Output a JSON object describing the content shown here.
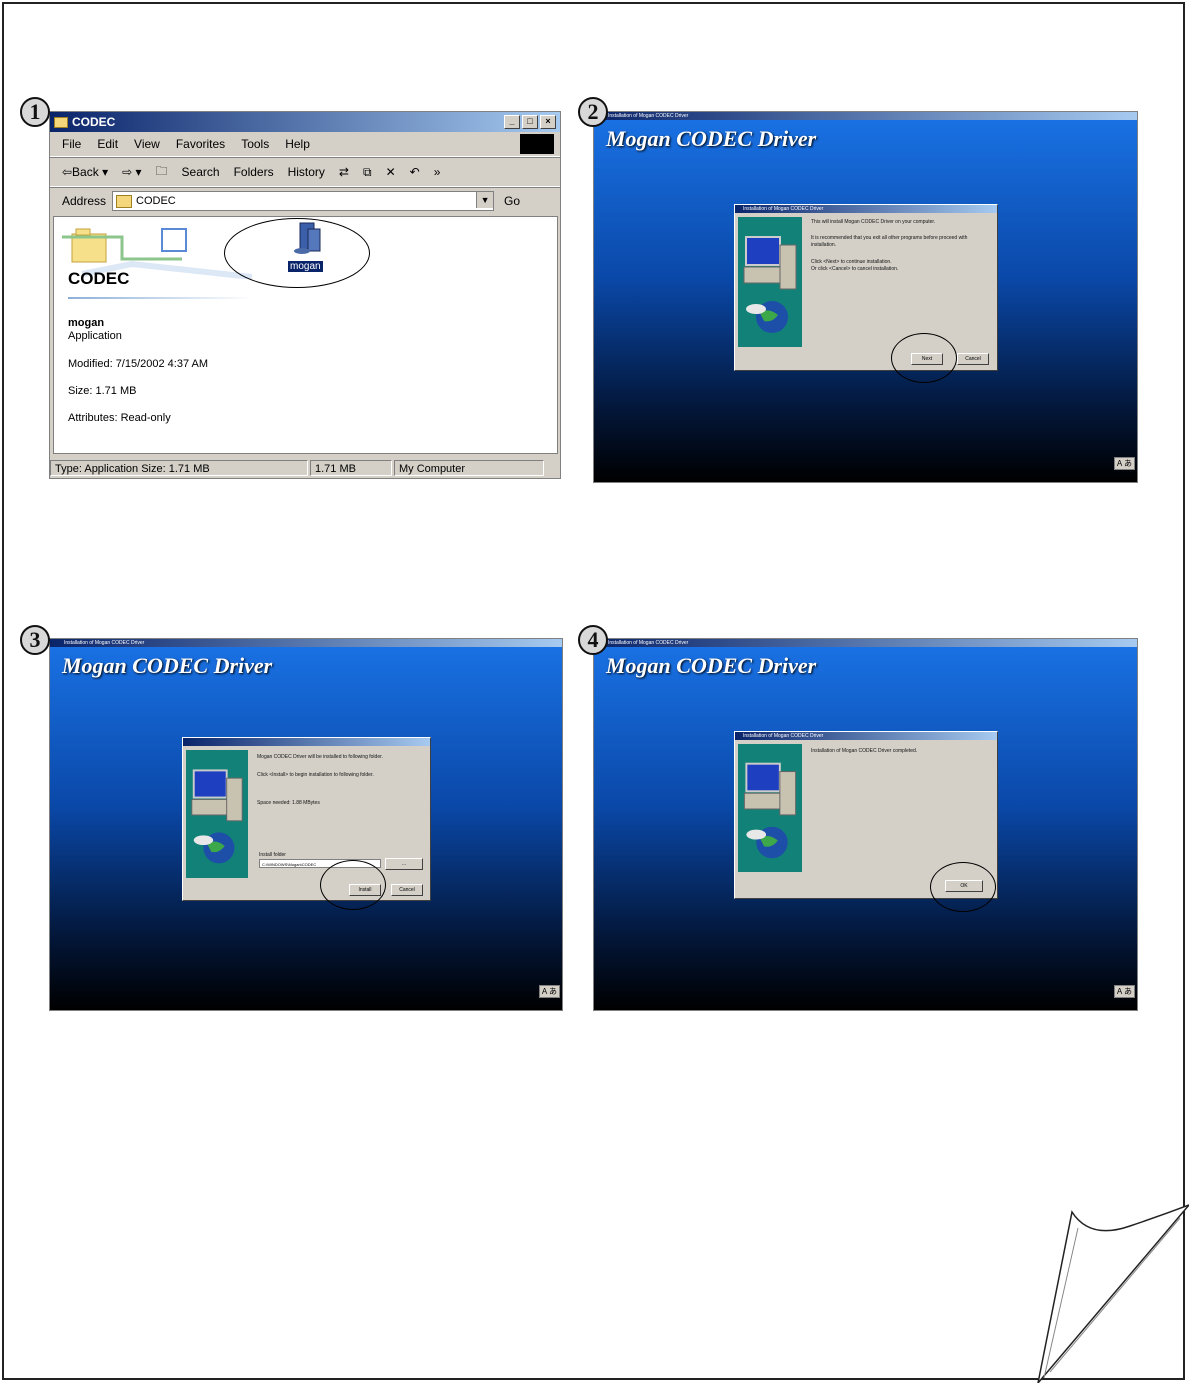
{
  "steps": [
    "1",
    "2",
    "3",
    "4"
  ],
  "explorer": {
    "title": "CODEC",
    "menu": [
      "File",
      "Edit",
      "View",
      "Favorites",
      "Tools",
      "Help"
    ],
    "toolbar": [
      "⇦Back ▾",
      "⇨ ▾",
      "🗀",
      "Search",
      "Folders",
      "History",
      "⇄",
      "⧉",
      "✕",
      "↶",
      "»"
    ],
    "address_label": "Address",
    "address_value": "CODEC",
    "go_label": "Go",
    "folder_title": "CODEC",
    "file_name": "mogan",
    "file_type": "Application",
    "modified": "Modified: 7/15/2002 4:37 AM",
    "size": "Size: 1.71 MB",
    "attributes": "Attributes: Read-only",
    "icon_label": "mogan",
    "status_left": "Type: Application Size: 1.71 MB",
    "status_mid": "1.71 MB",
    "status_right": "My Computer",
    "window_buttons": [
      "_",
      "□",
      "×"
    ]
  },
  "installers": [
    {
      "titlebar": "Installation of Mogan CODEC Driver",
      "heading": "Mogan CODEC Driver",
      "lang": "A あ",
      "dialog": {
        "title": "Installation of Mogan CODEC Driver",
        "lines": [
          "This will install Mogan CODEC Driver on your computer.",
          "It is recommended that you exit all other programs before proceed with installation.",
          "Click <Next> to continue installation.",
          "Or click <Cancel> to cancel installation."
        ],
        "buttons": [
          "Next",
          "Cancel"
        ]
      }
    },
    {
      "titlebar": "Installation of Mogan CODEC Driver",
      "heading": "Mogan CODEC Driver",
      "lang": "A あ",
      "dialog": {
        "title": "",
        "lines": [
          "Mogan CODEC Driver will be installed to following folder.",
          "Click <Install> to begin installation to following folder.",
          "Space needed: 1.88 MBytes"
        ],
        "field_label": "Install folder",
        "field_value": "C:\\WINDOWS\\Mogan\\CODEC",
        "browse": "...",
        "buttons": [
          "Install",
          "Cancel"
        ]
      }
    },
    {
      "titlebar": "Installation of Mogan CODEC Driver",
      "heading": "Mogan CODEC Driver",
      "lang": "A あ",
      "dialog": {
        "title": "Installation of Mogan CODEC Driver",
        "lines": [
          "Installation of Mogan CODEC Driver completed."
        ],
        "buttons": [
          "OK"
        ]
      }
    }
  ]
}
